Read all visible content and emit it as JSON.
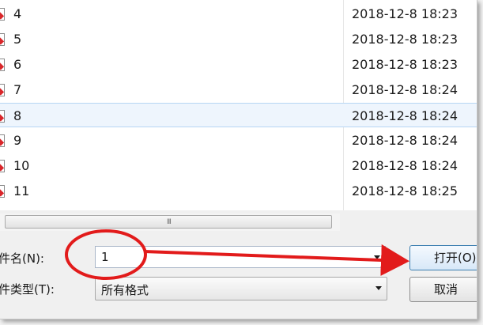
{
  "files": [
    {
      "name": "4",
      "date": "2018-12-8 18:23",
      "selected": false
    },
    {
      "name": "5",
      "date": "2018-12-8 18:23",
      "selected": false
    },
    {
      "name": "6",
      "date": "2018-12-8 18:23",
      "selected": false
    },
    {
      "name": "7",
      "date": "2018-12-8 18:24",
      "selected": false
    },
    {
      "name": "8",
      "date": "2018-12-8 18:24",
      "selected": true
    },
    {
      "name": "9",
      "date": "2018-12-8 18:24",
      "selected": false
    },
    {
      "name": "10",
      "date": "2018-12-8 18:24",
      "selected": false
    },
    {
      "name": "11",
      "date": "2018-12-8 18:25",
      "selected": false
    }
  ],
  "file_icon": "document-icon",
  "scrollbar": {
    "grip": "III"
  },
  "form": {
    "filename_label": "件名(N):",
    "filename_value": "1",
    "filetype_label": "件类型(T):",
    "filetype_value": "所有格式"
  },
  "buttons": {
    "open_label": "打开(O)",
    "cancel_label": "取消"
  },
  "annotation": {
    "color": "#e21b1b"
  }
}
